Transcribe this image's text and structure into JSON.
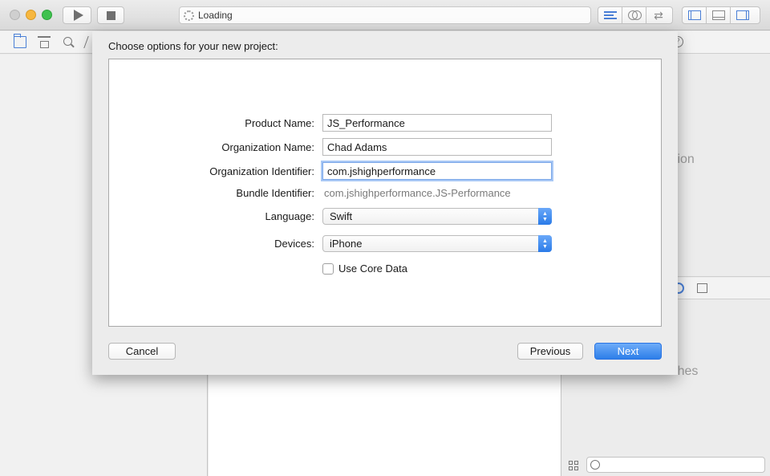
{
  "toolbar": {
    "activity_text": "Loading"
  },
  "utilities": {
    "partial_text": "ction",
    "no_matches": "No Matches"
  },
  "sheet": {
    "title": "Choose options for your new project:",
    "product_name": {
      "label": "Product Name:",
      "value": "JS_Performance"
    },
    "organization_name": {
      "label": "Organization Name:",
      "value": "Chad Adams"
    },
    "organization_identifier": {
      "label": "Organization Identifier:",
      "value": "com.jshighperformance"
    },
    "bundle_identifier": {
      "label": "Bundle Identifier:",
      "value": "com.jshighperformance.JS-Performance"
    },
    "language": {
      "label": "Language:",
      "value": "Swift"
    },
    "devices": {
      "label": "Devices:",
      "value": "iPhone"
    },
    "use_core_data": {
      "label": "Use Core Data",
      "checked": false
    },
    "buttons": {
      "cancel": "Cancel",
      "previous": "Previous",
      "next": "Next"
    }
  },
  "colors": {
    "accent": "#2d7ee9",
    "window_bg": "#ececec"
  }
}
